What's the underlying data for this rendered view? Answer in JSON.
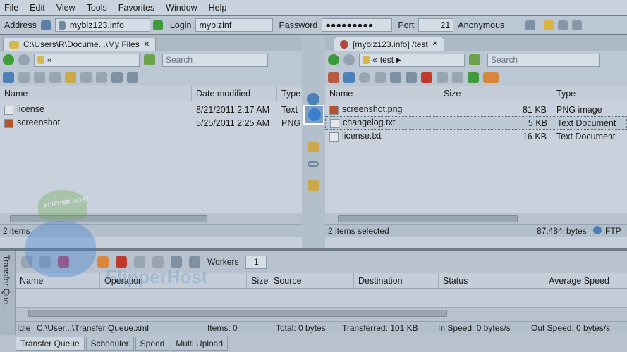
{
  "menu": [
    "File",
    "Edit",
    "View",
    "Tools",
    "Favorites",
    "Window",
    "Help"
  ],
  "connect": {
    "address_label": "Address",
    "address_value": "mybiz123.info",
    "login_label": "Login",
    "login_value": "mybizinf",
    "password_label": "Password",
    "password_value": "●●●●●●●●●",
    "port_label": "Port",
    "port_value": "21",
    "anonymous_label": "Anonymous"
  },
  "left": {
    "tab": "C:\\Users\\R\\Docume...\\My Files",
    "path": "«",
    "search_placeholder": "Search",
    "columns": [
      "Name",
      "Date modified",
      "Type"
    ],
    "files": [
      {
        "name": "license",
        "date": "8/21/2011 2:17 AM",
        "type": "Text"
      },
      {
        "name": "screenshot",
        "date": "5/25/2011 2:25 AM",
        "type": "PNG"
      }
    ],
    "status": "2 items"
  },
  "right": {
    "tab": "[mybiz123.info] /test",
    "path_prefix": "«",
    "path": "test",
    "search_placeholder": "Search",
    "columns": [
      "Name",
      "Size",
      "Type"
    ],
    "files": [
      {
        "name": "screenshot.png",
        "size": "81 KB",
        "type": "PNG image"
      },
      {
        "name": "changelog.txt",
        "size": "5 KB",
        "type": "Text Document"
      },
      {
        "name": "license.txt",
        "size": "16 KB",
        "type": "Text Document"
      }
    ],
    "status": "2 items selected",
    "bytes": "87,484",
    "bytes_label": "bytes",
    "protocol": "FTP"
  },
  "queue": {
    "side_label": "Transfer Que...",
    "workers_label": "Workers",
    "workers_value": "1",
    "columns": [
      "Name",
      "Operation",
      "Size",
      "Source",
      "Destination",
      "Status",
      "Average Speed"
    ],
    "status": {
      "idle": "Idle",
      "file": "C:\\User...\\Transfer Queue.xml",
      "items": "Items: 0",
      "total": "Total: 0 bytes",
      "transferred": "Transferred: 101 KB",
      "inspeed": "In Speed: 0 bytes/s",
      "outspeed": "Out Speed: 0 bytes/s"
    },
    "tabs": [
      "Transfer Queue",
      "Scheduler",
      "Speed",
      "Multi Upload"
    ]
  },
  "watermark": {
    "logo_text": "FLIPPER HOST",
    "brand": "FlipperHost"
  },
  "colors": {
    "accent": "#e8b84a",
    "selection": "#3a7fd0",
    "arrow_green": "#3f9a3a"
  }
}
